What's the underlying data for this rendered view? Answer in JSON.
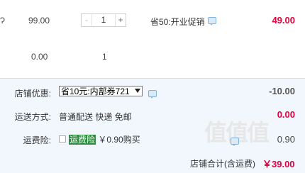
{
  "item": {
    "name_tail": "Ɂ",
    "unit_price": "99.00",
    "quantity": "1",
    "qty_minus": "-",
    "qty_plus": "+",
    "promotion": "省50:开业促销",
    "subtotal": "49.00"
  },
  "gift_item": {
    "unit_price": "0.00",
    "quantity": "1"
  },
  "shop": {
    "discount_label": "店铺优惠:",
    "discount_selected": "省10元:内部券721",
    "discount_amount": "-10.00",
    "shipping_label": "运送方式:",
    "shipping_option": "普通配送 快递 免邮",
    "shipping_amount": "0.00",
    "insurance_label": "运费险:",
    "insurance_highlight": "运费险",
    "insurance_price_text": "￥0.90购买",
    "insurance_amount": "0.90",
    "total_label": "店铺合计(含运费)",
    "total_amount": "￥39.00"
  },
  "watermark_text": "值值值",
  "colors": {
    "accent_red": "#e4003a",
    "shop_bg": "#f2f7fd",
    "highlight_green": "#2e8b3e"
  },
  "icons": [
    "message-icon",
    "checkbox-icon",
    "dropdown-arrow-icon"
  ]
}
